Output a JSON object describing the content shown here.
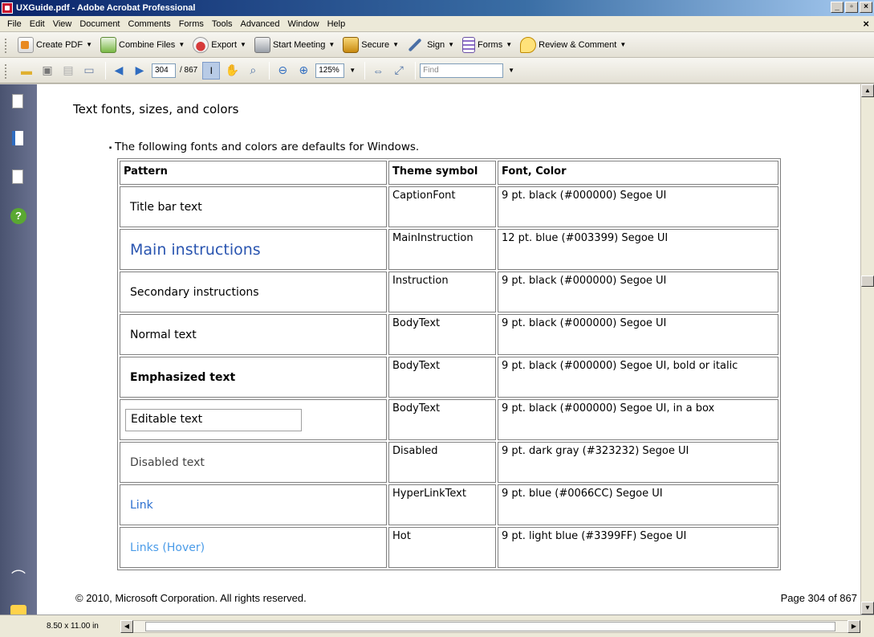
{
  "window": {
    "title": "UXGuide.pdf - Adobe Acrobat Professional"
  },
  "menu": [
    "File",
    "Edit",
    "View",
    "Document",
    "Comments",
    "Forms",
    "Tools",
    "Advanced",
    "Window",
    "Help"
  ],
  "toolbar_tasks": {
    "create_pdf": "Create PDF",
    "combine_files": "Combine Files",
    "export": "Export",
    "start_meeting": "Start Meeting",
    "secure": "Secure",
    "sign": "Sign",
    "forms": "Forms",
    "review_comment": "Review & Comment"
  },
  "navigation": {
    "current_page": "304",
    "total_pages": "/ 867",
    "zoom": "125%",
    "find_placeholder": "Find"
  },
  "document": {
    "heading": "Text fonts, sizes, and colors",
    "bullet": "The following fonts and colors are defaults for Windows.",
    "table": {
      "headers": [
        "Pattern",
        "Theme symbol",
        "Font, Color"
      ],
      "rows": [
        {
          "pattern": "Title bar text",
          "symbol": "CaptionFont",
          "font": "9 pt. black (#000000) Segoe UI"
        },
        {
          "pattern": "Main instructions",
          "symbol": "MainInstruction",
          "font": "12 pt. blue (#003399) Segoe UI"
        },
        {
          "pattern": "Secondary instructions",
          "symbol": "Instruction",
          "font": "9 pt. black (#000000) Segoe UI"
        },
        {
          "pattern": "Normal text",
          "symbol": "BodyText",
          "font": "9 pt. black (#000000) Segoe UI"
        },
        {
          "pattern": "Emphasized text",
          "symbol": "BodyText",
          "font": "9 pt. black (#000000) Segoe UI, bold or italic"
        },
        {
          "pattern": "Editable text",
          "symbol": "BodyText",
          "font": "9 pt. black (#000000) Segoe UI, in a box"
        },
        {
          "pattern": "Disabled text",
          "symbol": "Disabled",
          "font": "9 pt. dark gray (#323232) Segoe UI"
        },
        {
          "pattern": "Link",
          "symbol": "HyperLinkText",
          "font": "9 pt. blue (#0066CC) Segoe UI"
        },
        {
          "pattern": "Links (Hover)",
          "symbol": "Hot",
          "font": "9 pt. light blue (#3399FF) Segoe UI"
        }
      ]
    },
    "footer_left": "© 2010, Microsoft Corporation. All rights reserved.",
    "footer_right": "Page 304 of 867"
  },
  "status": {
    "page_size": "8.50 x 11.00 in"
  },
  "colors": {
    "main_instruction": "#003399",
    "disabled": "#323232",
    "link": "#0066CC",
    "link_hover": "#3399FF"
  }
}
